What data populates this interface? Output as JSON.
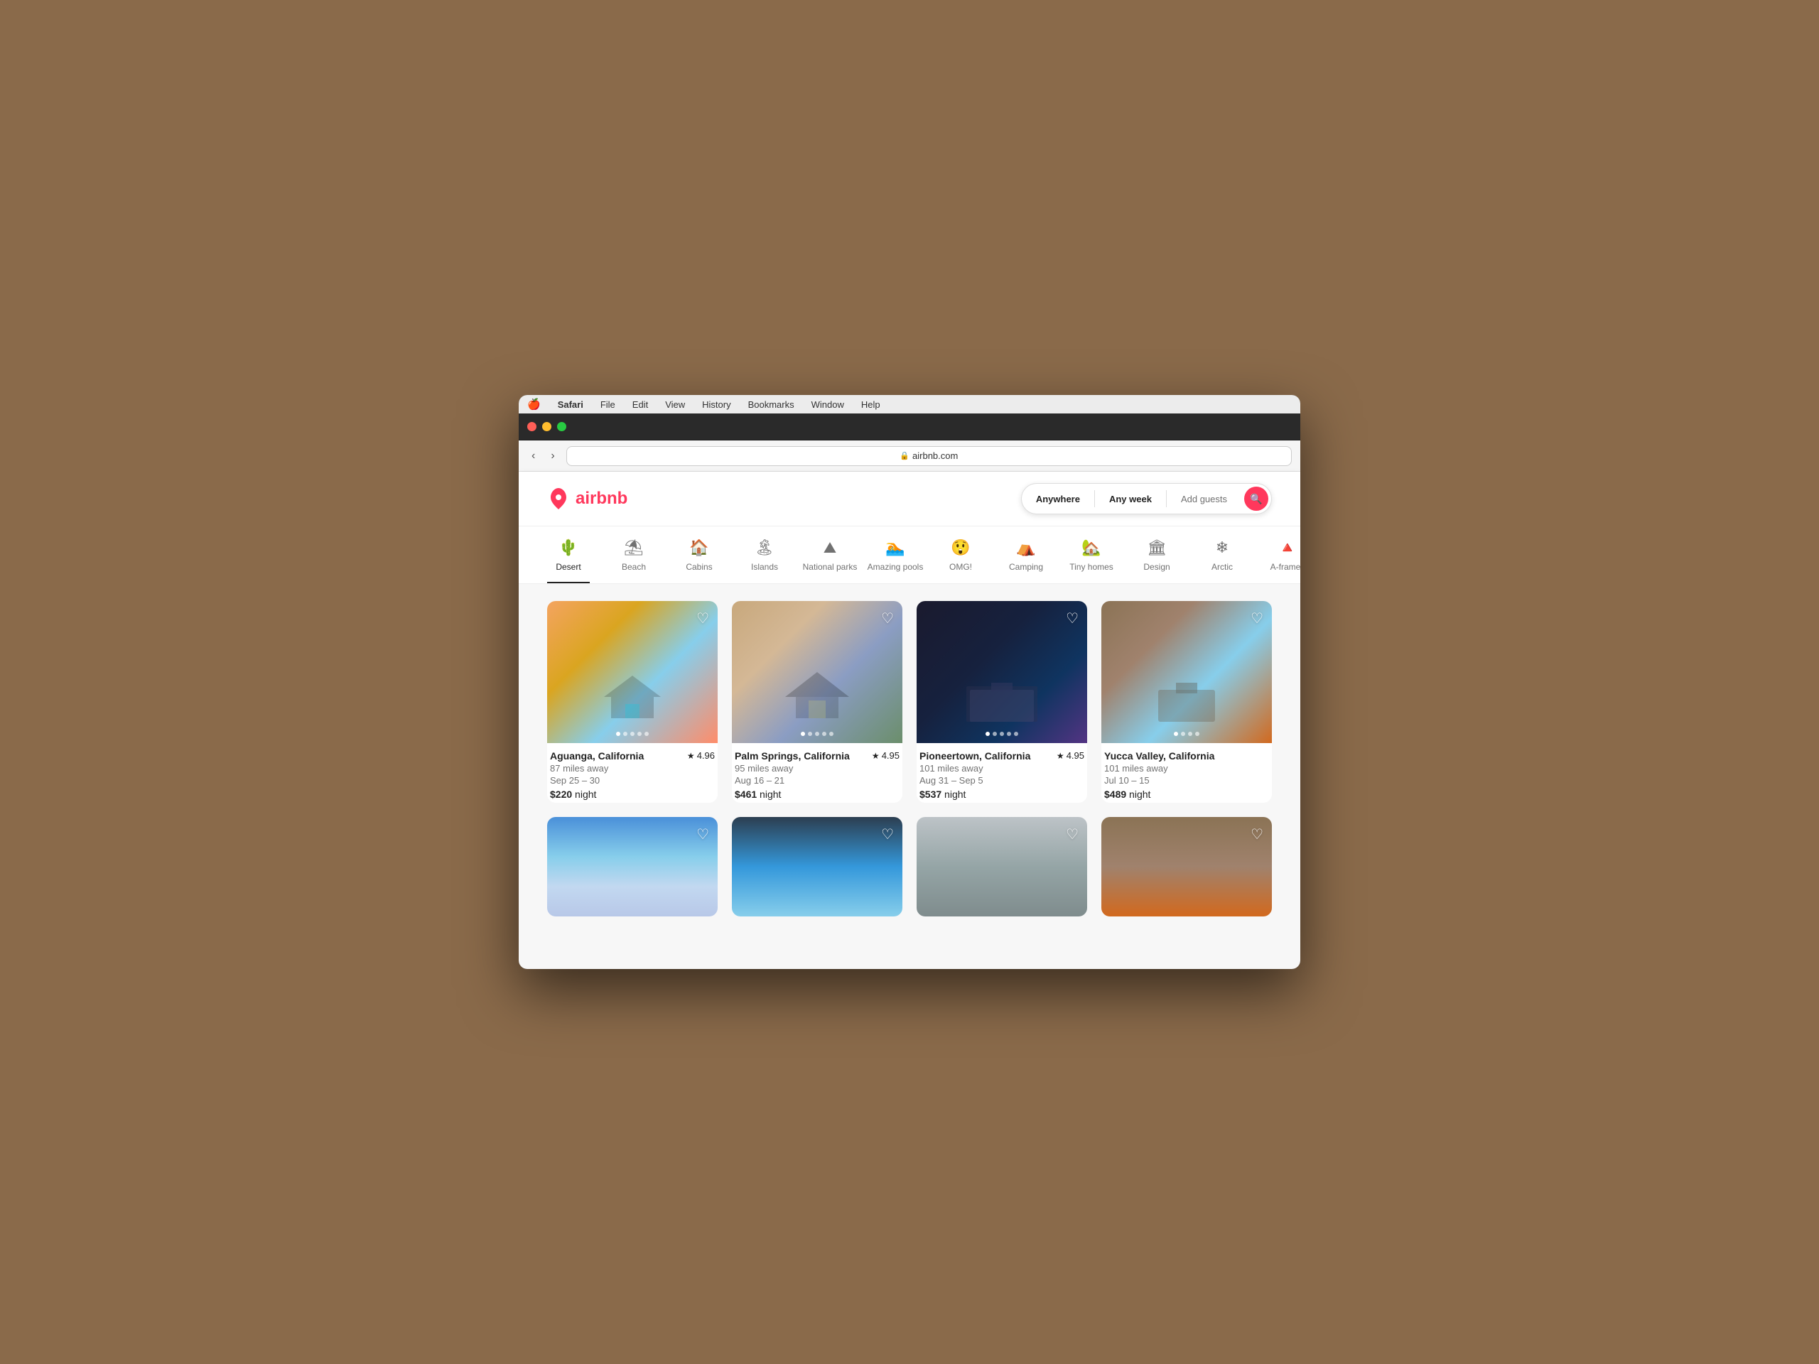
{
  "browser": {
    "menu_items": [
      "🍎",
      "Safari",
      "File",
      "Edit",
      "View",
      "History",
      "Bookmarks",
      "Window",
      "Help"
    ],
    "address": "airbnb.com",
    "back_label": "‹",
    "forward_label": "›"
  },
  "header": {
    "logo_text": "airbnb",
    "search": {
      "anywhere_label": "Anywhere",
      "week_label": "Any week",
      "guests_label": "Add guests",
      "search_icon": "🔍"
    }
  },
  "categories": [
    {
      "id": "desert",
      "label": "Desert",
      "icon": "🌵",
      "active": true
    },
    {
      "id": "beach",
      "label": "Beach",
      "icon": "⛱"
    },
    {
      "id": "cabins",
      "label": "Cabins",
      "icon": "🏠"
    },
    {
      "id": "islands",
      "label": "Islands",
      "icon": "🏝"
    },
    {
      "id": "national-parks",
      "label": "National parks",
      "icon": "⛰"
    },
    {
      "id": "amazing-pools",
      "label": "Amazing pools",
      "icon": "🏊"
    },
    {
      "id": "omg",
      "label": "OMG!",
      "icon": "😲"
    },
    {
      "id": "camping",
      "label": "Camping",
      "icon": "⛺"
    },
    {
      "id": "tiny-homes",
      "label": "Tiny homes",
      "icon": "🏡"
    },
    {
      "id": "design",
      "label": "Design",
      "icon": "🏛"
    },
    {
      "id": "arctic",
      "label": "Arctic",
      "icon": "❄"
    },
    {
      "id": "a-frames",
      "label": "A-frames",
      "icon": "🔺"
    }
  ],
  "listings": [
    {
      "id": 1,
      "location": "Aguanga, California",
      "distance": "87 miles away",
      "dates": "Sep 25 – 30",
      "price": "$220",
      "rating": "4.96",
      "img_class": "img-desert1",
      "dots": 5
    },
    {
      "id": 2,
      "location": "Palm Springs, California",
      "distance": "95 miles away",
      "dates": "Aug 16 – 21",
      "price": "$461",
      "rating": "4.95",
      "img_class": "img-desert2",
      "dots": 5
    },
    {
      "id": 3,
      "location": "Pioneertown, California",
      "distance": "101 miles away",
      "dates": "Aug 31 – Sep 5",
      "price": "$537",
      "rating": "4.95",
      "img_class": "img-desert3",
      "dots": 5
    },
    {
      "id": 4,
      "location": "Yucca Valley, California",
      "distance": "101 miles away",
      "dates": "Jul 10 – 15",
      "price": "$489",
      "rating": "",
      "img_class": "img-desert4",
      "dots": 4
    }
  ],
  "listings_row2": [
    {
      "id": 5,
      "img_class": "img-bottom1"
    },
    {
      "id": 6,
      "img_class": "img-bottom2"
    },
    {
      "id": 7,
      "img_class": "img-bottom3"
    },
    {
      "id": 8,
      "img_class": "img-bottom4"
    }
  ],
  "night_label": "night"
}
